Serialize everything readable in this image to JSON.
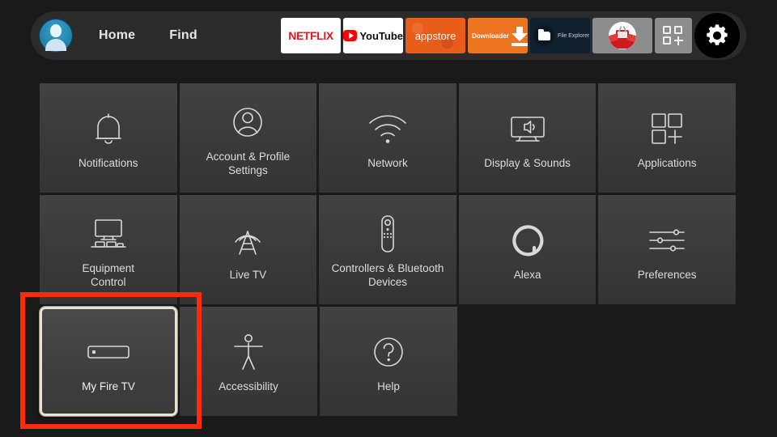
{
  "nav": {
    "avatar": "profile-avatar",
    "links": [
      {
        "label": "Home"
      },
      {
        "label": "Find"
      }
    ],
    "apps": [
      {
        "name": "netflix",
        "label": "NETFLIX"
      },
      {
        "name": "youtube",
        "label": "YouTube"
      },
      {
        "name": "appstore",
        "label": "appstore"
      },
      {
        "name": "downloader",
        "label": "Downloader"
      },
      {
        "name": "file-explorer",
        "label": "File Explorer"
      },
      {
        "name": "red-tv-app",
        "label": ""
      },
      {
        "name": "app-grid",
        "label": ""
      },
      {
        "name": "settings-gear",
        "label": ""
      }
    ]
  },
  "grid": {
    "rows": [
      [
        {
          "icon": "bell-icon",
          "label": "Notifications"
        },
        {
          "icon": "person-circle-icon",
          "label": "Account & Profile\nSettings"
        },
        {
          "icon": "wifi-icon",
          "label": "Network"
        },
        {
          "icon": "tv-speaker-icon",
          "label": "Display & Sounds"
        },
        {
          "icon": "app-squares-plus-icon",
          "label": "Applications"
        }
      ],
      [
        {
          "icon": "monitor-equipment-icon",
          "label": "Equipment\nControl"
        },
        {
          "icon": "antenna-icon",
          "label": "Live TV"
        },
        {
          "icon": "remote-control-icon",
          "label": "Controllers & Bluetooth\nDevices"
        },
        {
          "icon": "alexa-ring-icon",
          "label": "Alexa"
        },
        {
          "icon": "sliders-icon",
          "label": "Preferences"
        }
      ],
      [
        {
          "icon": "fire-tv-stick-icon",
          "label": "My Fire TV",
          "focused": true
        },
        {
          "icon": "accessibility-person-icon",
          "label": "Accessibility"
        },
        {
          "icon": "question-circle-icon",
          "label": "Help"
        }
      ]
    ]
  },
  "annotation": {
    "color": "#fb2c0a",
    "target": "My Fire TV"
  },
  "colors": {
    "background": "#1a1a1a",
    "navbar": "#2b2b2b",
    "tile": "#3b3a3a",
    "focus_border": "#e8e2d2",
    "text": "#dcdcdc",
    "annotation": "#fb2c0a"
  }
}
